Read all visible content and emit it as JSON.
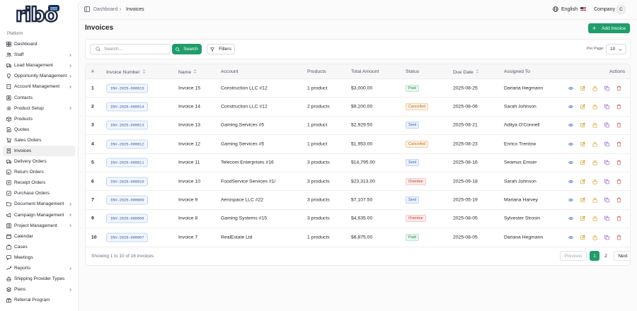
{
  "sidebar": {
    "section_label": "Platform",
    "items": [
      {
        "label": "Dashboard",
        "icon": "dashboard-icon",
        "chevron": false
      },
      {
        "label": "Staff",
        "icon": "users-icon",
        "chevron": true
      },
      {
        "label": "Load Management",
        "icon": "truck-icon",
        "chevron": true
      },
      {
        "label": "Opportunity Management",
        "icon": "lightbulb-icon",
        "chevron": true
      },
      {
        "label": "Account Management",
        "icon": "building-icon",
        "chevron": true
      },
      {
        "label": "Contacts",
        "icon": "contacts-icon",
        "chevron": false
      },
      {
        "label": "Product Setup",
        "icon": "settings-icon",
        "chevron": true
      },
      {
        "label": "Products",
        "icon": "box-icon",
        "chevron": false
      },
      {
        "label": "Quotes",
        "icon": "quote-icon",
        "chevron": false
      },
      {
        "label": "Sales Orders",
        "icon": "cart-icon",
        "chevron": false
      },
      {
        "label": "Invoices",
        "icon": "invoice-icon",
        "chevron": false,
        "active": true
      },
      {
        "label": "Delivery Orders",
        "icon": "delivery-icon",
        "chevron": false
      },
      {
        "label": "Return Orders",
        "icon": "return-icon",
        "chevron": false
      },
      {
        "label": "Receipt Orders",
        "icon": "receipt-icon",
        "chevron": false
      },
      {
        "label": "Purchase Orders",
        "icon": "purchase-icon",
        "chevron": false
      },
      {
        "label": "Document Management",
        "icon": "folder-icon",
        "chevron": true
      },
      {
        "label": "Campaign Management",
        "icon": "megaphone-icon",
        "chevron": true
      },
      {
        "label": "Project Management",
        "icon": "kanban-icon",
        "chevron": true
      },
      {
        "label": "Calendar",
        "icon": "calendar-icon",
        "chevron": false
      },
      {
        "label": "Cases",
        "icon": "briefcase-icon",
        "chevron": false
      },
      {
        "label": "Meetings",
        "icon": "meeting-icon",
        "chevron": false
      },
      {
        "label": "Reports",
        "icon": "chart-icon",
        "chevron": true
      },
      {
        "label": "Shipping Provider Types",
        "icon": "ship-icon",
        "chevron": false
      },
      {
        "label": "Plans",
        "icon": "layers-icon",
        "chevron": true
      },
      {
        "label": "Referral Program",
        "icon": "gift-icon",
        "chevron": false
      }
    ]
  },
  "topbar": {
    "breadcrumb_root": "Dashboard",
    "breadcrumb_sep": "›",
    "breadcrumb_current": "Invoices",
    "language": "English",
    "company_label": "Company",
    "avatar_initial": "C"
  },
  "page": {
    "title": "Invoices",
    "add_button": "Add Invoice"
  },
  "search": {
    "placeholder": "Search...",
    "button": "Search",
    "filters": "Filters",
    "per_page_label": "Per Page:",
    "per_page_value": "10"
  },
  "table": {
    "headers": [
      "#",
      "Invoice Number",
      "Name",
      "Account",
      "Products",
      "Total Amount",
      "Status",
      "Due Date",
      "Assigned To",
      "Actions"
    ],
    "rows": [
      {
        "n": "1",
        "number": "INV-2025-000015",
        "name": "Invoice 15",
        "account": "Construction LLC #12",
        "products": "1 product",
        "amount": "$3,000.00",
        "status": "Paid",
        "status_kind": "paid",
        "due": "2025-08-25",
        "assigned": "Dariana Hegmann"
      },
      {
        "n": "2",
        "number": "INV-2025-000014",
        "name": "Invoice 14",
        "account": "Construction LLC #12",
        "products": "2 products",
        "amount": "$9,200.00",
        "status": "Cancelled",
        "status_kind": "cancelled",
        "due": "2025-08-06",
        "assigned": "Sarah Johnson"
      },
      {
        "n": "3",
        "number": "INV-2025-000013",
        "name": "Invoice 13",
        "account": "Gaming Services #5",
        "products": "1 product",
        "amount": "$2,929.50",
        "status": "Sent",
        "status_kind": "sent",
        "due": "2025-08-21",
        "assigned": "Aditya O'Connell"
      },
      {
        "n": "4",
        "number": "INV-2025-000012",
        "name": "Invoice 12",
        "account": "Gaming Services #5",
        "products": "1 product",
        "amount": "$1,953.00",
        "status": "Cancelled",
        "status_kind": "cancelled",
        "due": "2025-08-23",
        "assigned": "Enrico Trentow"
      },
      {
        "n": "5",
        "number": "INV-2025-000011",
        "name": "Invoice 11",
        "account": "Telecom Enterprises #16",
        "products": "3 products",
        "amount": "$14,795.00",
        "status": "Sent",
        "status_kind": "sent",
        "due": "2025-08-16",
        "assigned": "Seamus Emser"
      },
      {
        "n": "6",
        "number": "INV-2025-000010",
        "name": "Invoice 10",
        "account": "FoodService Services #1/",
        "products": "3 products",
        "amount": "$23,313.00",
        "status": "Overdue",
        "status_kind": "overdue",
        "due": "2025-09-18",
        "assigned": "Sarah Johnson"
      },
      {
        "n": "7",
        "number": "INV-2025-000009",
        "name": "Invoice 9",
        "account": "Aerospace LLC #22",
        "products": "3 products",
        "amount": "$7,107.50",
        "status": "Sent",
        "status_kind": "sent",
        "due": "2025-05-19",
        "assigned": "Mariana Harvey"
      },
      {
        "n": "9",
        "number": "INV-2025-000008",
        "name": "Invoice 8",
        "account": "Gaming Systems #15",
        "products": "3 products",
        "amount": "$4,635.00",
        "status": "Overdue",
        "status_kind": "overdue",
        "due": "2025-08-05",
        "assigned": "Sylvester Strosin"
      },
      {
        "n": "10",
        "number": "INV-2025-000007",
        "name": "Invoice 7",
        "account": "RealEstate Ltd",
        "products": "1 products",
        "amount": "$6,875.00",
        "status": "Paid",
        "status_kind": "paid",
        "due": "2025-08-05",
        "assigned": "Dariana Hegmann"
      }
    ]
  },
  "pagination": {
    "summary": "Showing 1 to 10 of 16 invoices",
    "previous": "Previous",
    "pages": [
      "1",
      "2"
    ],
    "current": "1",
    "next": "Next"
  },
  "colors": {
    "brand": "#1f9d6b",
    "view_icon": "#3b6fd8",
    "edit_icon": "#d49a1c",
    "lock_icon": "#d49a1c",
    "copy_icon": "#8b4fd6",
    "delete_icon": "#d64545"
  }
}
